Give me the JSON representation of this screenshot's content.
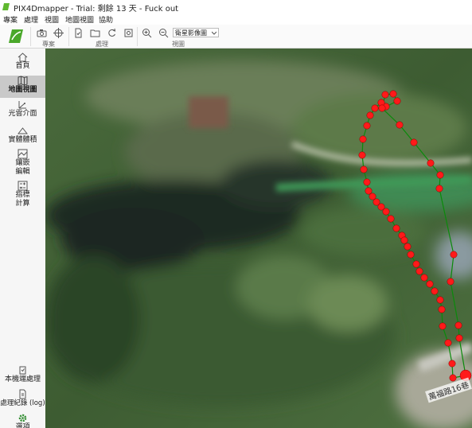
{
  "window": {
    "title": "PIX4Dmapper - Trial: 剩餘 13 天 - Fuck out"
  },
  "menu": [
    "專案",
    "處理",
    "視圖",
    "地圖視圖",
    "協助"
  ],
  "toolbar": {
    "groups": [
      {
        "label": "專案"
      },
      {
        "label": "處理"
      },
      {
        "label": "視圖"
      }
    ],
    "basemap_select": {
      "value": "衛星影像圖"
    }
  },
  "sidebar": {
    "items": [
      {
        "label": "首頁",
        "icon": "home-icon"
      },
      {
        "label": "地圖視圖",
        "icon": "map-icon",
        "active": true
      },
      {
        "label": "光雲介面",
        "icon": "point-cloud-icon"
      },
      {
        "label": "實體體積",
        "icon": "volume-icon"
      },
      {
        "label": "鑲嵌\n編輯",
        "icon": "mosaic-icon"
      },
      {
        "label": "指標\n計算",
        "icon": "index-calculator-icon"
      }
    ],
    "bottom_items": [
      {
        "label": "本機端處理",
        "icon": "local-processing-icon"
      },
      {
        "label": "處理紀錄 (log)",
        "icon": "log-icon"
      },
      {
        "label": "選項",
        "icon": "gear-icon"
      }
    ]
  },
  "map": {
    "road_label": "萬福路16巷",
    "flight_path_color": "#0a8a0a",
    "marker_color": "#ff1a1a"
  }
}
